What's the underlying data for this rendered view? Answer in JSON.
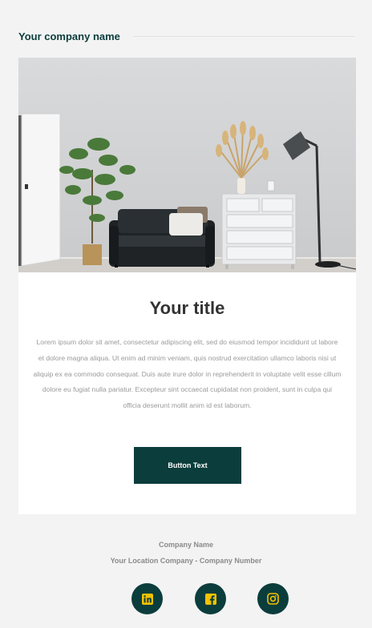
{
  "header": {
    "company_name": "Your company name"
  },
  "hero": {
    "image_alt": "living room with sofa, plant, dresser and floor lamp"
  },
  "content": {
    "title": "Your title",
    "body": "Lorem ipsum dolor sit amet, consectetur adipiscing elit, sed do eiusmod tempor incididunt ut labore et dolore magna aliqua. Ut enim ad minim veniam, quis nostrud exercitation ullamco laboris nisi ut aliquip ex ea commodo consequat. Duis aute irure dolor in reprehenderit in voluptate velit esse cillum dolore eu fugiat nulla pariatur. Excepteur sint occaecat cupidatat non proident, sunt in culpa qui officia deserunt mollit anim id est laborum.",
    "button_label": "Button Text"
  },
  "footer": {
    "company_name": "Company Name",
    "location_line": "Your Location Company - Company Number",
    "social": [
      {
        "icon": "linkedin-icon"
      },
      {
        "icon": "facebook-icon"
      },
      {
        "icon": "instagram-icon"
      }
    ]
  },
  "colors": {
    "brand": "#0b3d3c",
    "icon_accent": "#f2c200",
    "background": "#f3f3f3",
    "card": "#ffffff"
  }
}
